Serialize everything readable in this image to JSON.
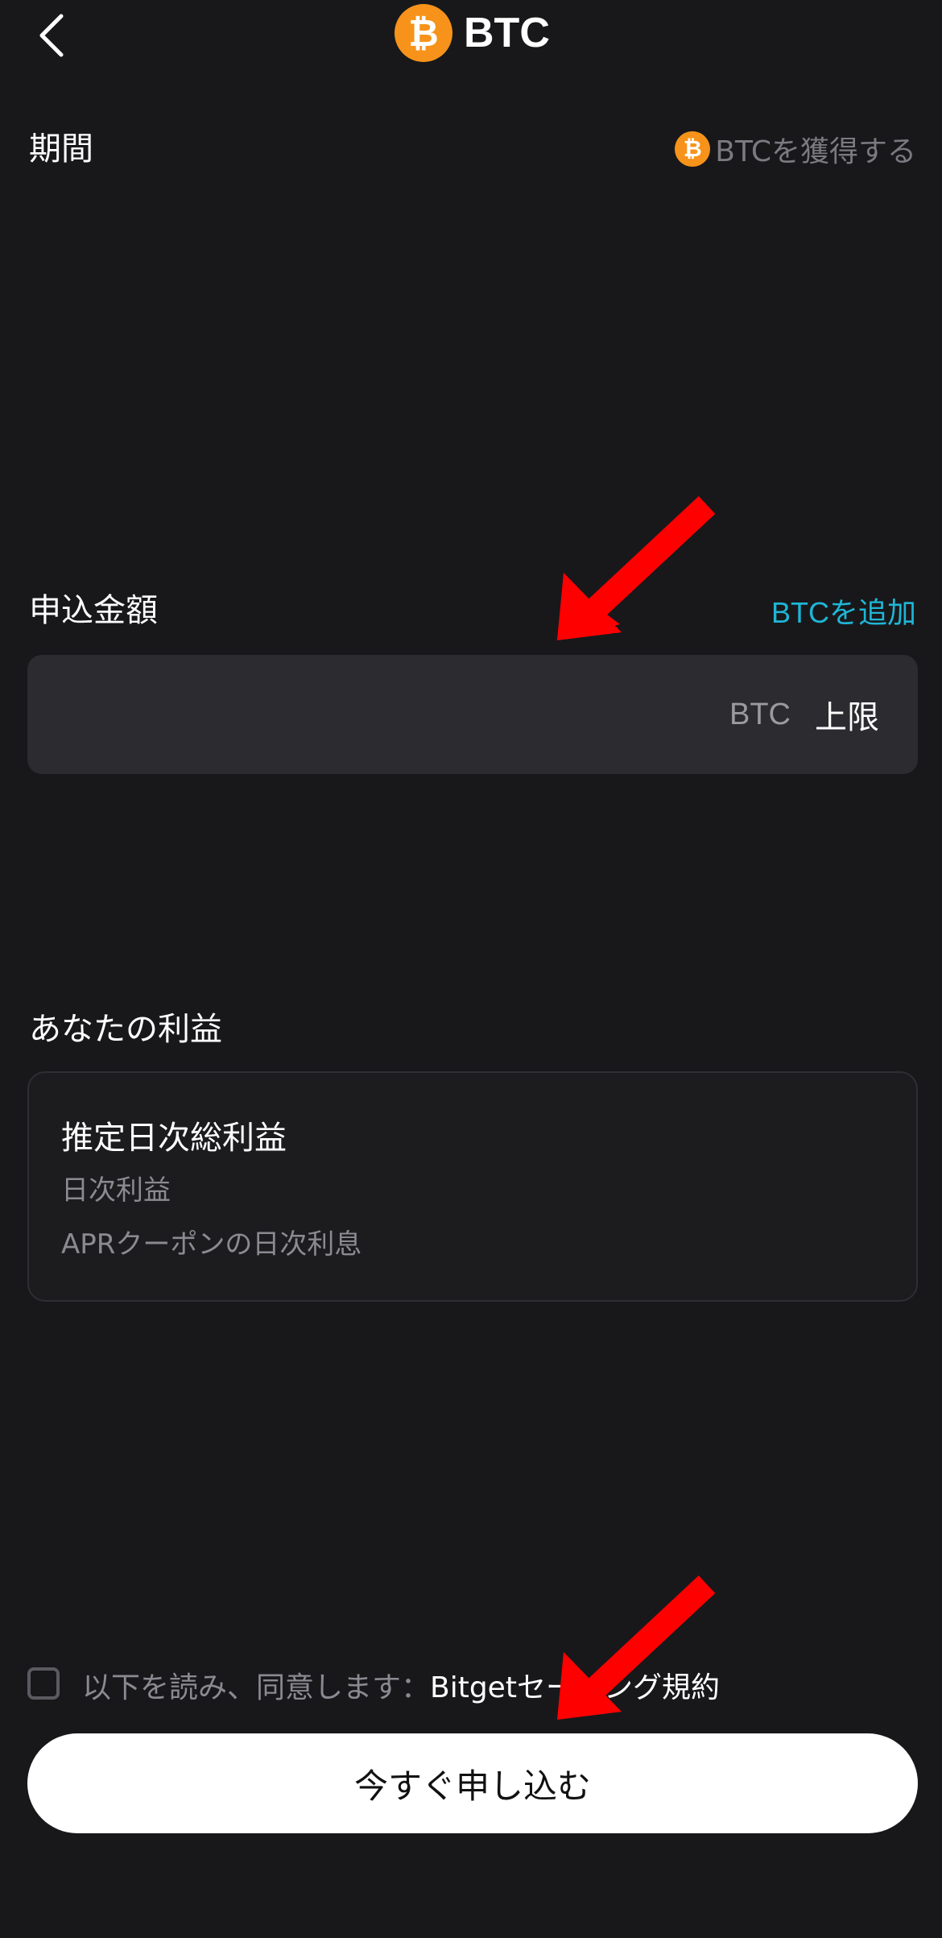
{
  "header": {
    "coin_symbol": "₿",
    "title": "BTC"
  },
  "period": {
    "label": "期間",
    "earn_link": "BTCを獲得する"
  },
  "amount": {
    "label": "申込金額",
    "add_link": "BTCを追加",
    "input_value": "",
    "unit": "BTC",
    "max_label": "上限"
  },
  "profit": {
    "label": "あなたの利益",
    "total_label": "推定日次総利益",
    "daily_label": "日次利益",
    "coupon_label": "APRクーポンの日次利息"
  },
  "agreement": {
    "prefix": "以下を読み、同意します：",
    "link": "Bitgetセービング規約",
    "checked": false
  },
  "submit": {
    "label": "今すぐ申し込む"
  },
  "colors": {
    "background": "#18181b",
    "accent_link": "#1fb6d6",
    "btc_orange": "#f7931a",
    "annotation_arrow": "#ff0000"
  }
}
